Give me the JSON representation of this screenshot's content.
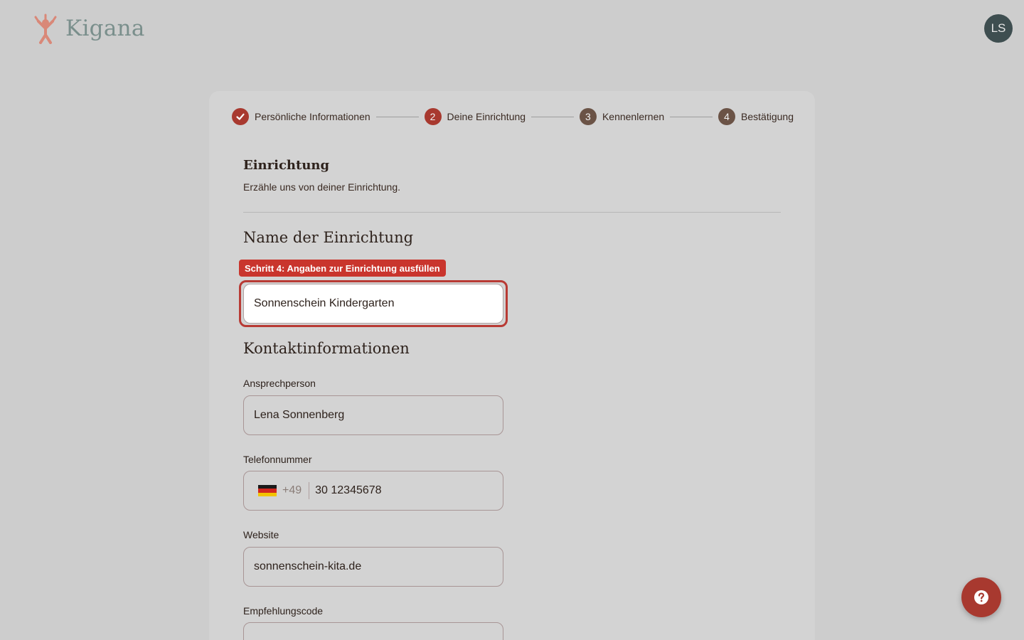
{
  "brand": {
    "name": "Kigana",
    "logo_color": "#d98878"
  },
  "user": {
    "initials": "LS"
  },
  "stepper": {
    "steps": [
      {
        "label": "Persönliche Informationen",
        "state": "done",
        "icon": "check-icon"
      },
      {
        "label": "Deine Einrichtung",
        "number": "2",
        "state": "active"
      },
      {
        "label": "Kennenlernen",
        "number": "3",
        "state": "upcoming"
      },
      {
        "label": "Bestätigung",
        "number": "4",
        "state": "upcoming"
      }
    ]
  },
  "section": {
    "title": "Einrichtung",
    "description": "Erzähle uns von deiner Einrichtung."
  },
  "facility": {
    "heading": "Name der Einrichtung",
    "tooltip": "Schritt 4: Angaben zur Einrichtung ausfüllen",
    "name_value": "Sonnenschein Kindergarten"
  },
  "contact": {
    "heading": "Kontaktinformationen",
    "person_label": "Ansprechperson",
    "person_value": "Lena Sonnenberg",
    "phone_label": "Telefonnummer",
    "phone_prefix": "+49",
    "phone_value": "30 12345678",
    "website_label": "Website",
    "website_value": "sonnenschein-kita.de",
    "referral_label": "Empfehlungscode",
    "referral_value": ""
  },
  "colors": {
    "accent": "#a8392f",
    "highlight": "#c9352d",
    "step_upcoming": "#6b5346"
  },
  "help": {
    "icon": "question-icon"
  }
}
